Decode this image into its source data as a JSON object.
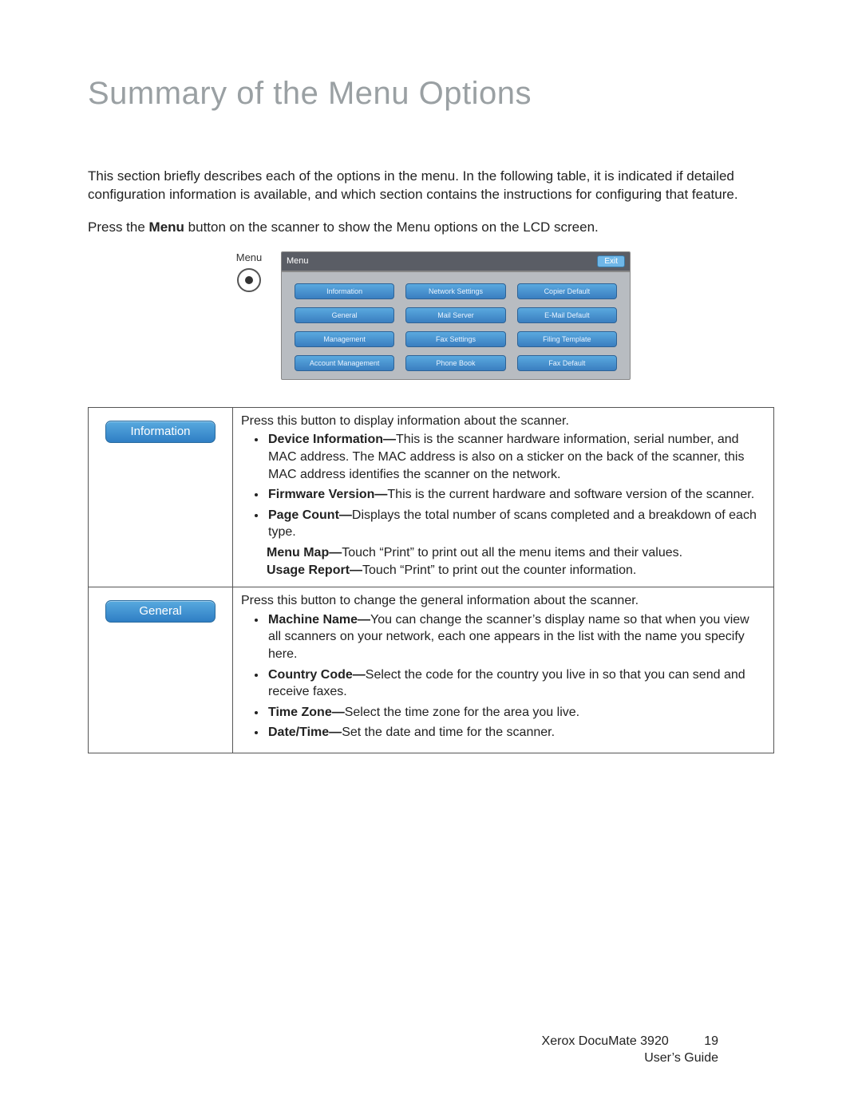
{
  "title": "Summary of the Menu Options",
  "intro1": "This section briefly describes each of the options in the menu. In the following table, it is indicated if detailed configuration information is available, and which section contains the instructions for configuring that feature.",
  "intro2_pre": "Press the ",
  "intro2_bold": "Menu",
  "intro2_post": " button on the scanner to show the Menu options on the LCD screen.",
  "hw_label": "Menu",
  "lcd": {
    "title": "Menu",
    "exit": "Exit",
    "buttons": [
      "Information",
      "Network Settings",
      "Copier Default",
      "General",
      "Mail Server",
      "E-Mail Default",
      "Management",
      "Fax Settings",
      "Filing Template",
      "Account Management",
      "Phone Book",
      "Fax Default"
    ]
  },
  "rows": [
    {
      "button": "Information",
      "lead": "Press this button to display information about the scanner.",
      "items": [
        {
          "term": "Device Information—",
          "text": "This is the scanner hardware information, serial number, and MAC address. The MAC address is also on a sticker on the back of the scanner, this MAC address identifies the scanner on the network."
        },
        {
          "term": "Firmware Version—",
          "text": "This is the current hardware and software version of the scanner."
        },
        {
          "term": "Page Count—",
          "text": "Displays the total number of scans completed and a breakdown of each type."
        }
      ],
      "tail": [
        {
          "term": "Menu Map—",
          "text": "Touch “Print” to print out all the menu items and their values."
        },
        {
          "term": "Usage Report—",
          "text": "Touch “Print” to print out the counter information."
        }
      ]
    },
    {
      "button": "General",
      "lead": "Press this button to change the general information about the scanner.",
      "items": [
        {
          "term": "Machine Name—",
          "text": "You can change the scanner’s display name so that when you view all scanners on your network, each one appears in the list with the name you specify here."
        },
        {
          "term": "Country Code—",
          "text": "Select the code for the country you live in so that you can send and receive faxes."
        },
        {
          "term": "Time Zone—",
          "text": "Select the time zone for the area you live."
        },
        {
          "term": "Date/Time—",
          "text": "Set the date and time for the scanner."
        }
      ],
      "tail": []
    }
  ],
  "footer": {
    "line1a": "Xerox DocuMate 3920",
    "page": "19",
    "line2": "User’s Guide"
  }
}
